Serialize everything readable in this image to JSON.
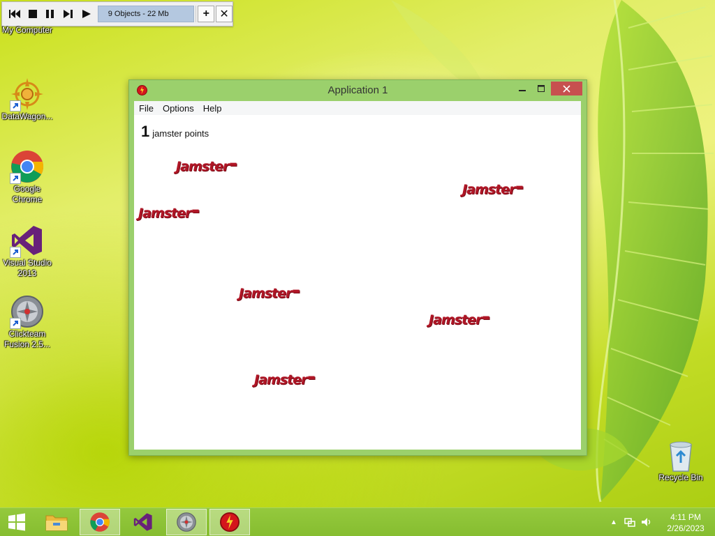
{
  "toolbar": {
    "status": "9 Objects - 22 Mb",
    "icons": [
      "restart-icon",
      "stop-icon",
      "pause-icon",
      "step-icon",
      "play-icon",
      "plus-icon",
      "close-icon"
    ],
    "plus_label": "+",
    "close_label": "✕"
  },
  "desktop": {
    "icons": [
      {
        "label": "My Computer"
      },
      {
        "label": "DataWagon..."
      },
      {
        "label": "Google Chrome"
      },
      {
        "label": "Visual Studio 2013"
      },
      {
        "label": "Clickteam Fusion 2.5..."
      },
      {
        "label": "Recycle Bin"
      }
    ]
  },
  "window": {
    "title": "Application 1",
    "menu": [
      "File",
      "Options",
      "Help"
    ],
    "score_value": "1",
    "score_label": "jamster points",
    "sprite_text": "Jamster",
    "sprite_count": 6
  },
  "taskbar": {
    "apps": [
      "windows-start",
      "file-explorer",
      "google-chrome",
      "visual-studio",
      "clickteam-fusion",
      "application-1"
    ],
    "time": "4:11 PM",
    "date": "2/26/2023"
  },
  "colors": {
    "accent_green": "#9bd06c",
    "close_red": "#c7504f",
    "sprite_red": "#b01626",
    "taskbar": "#8cc236"
  }
}
